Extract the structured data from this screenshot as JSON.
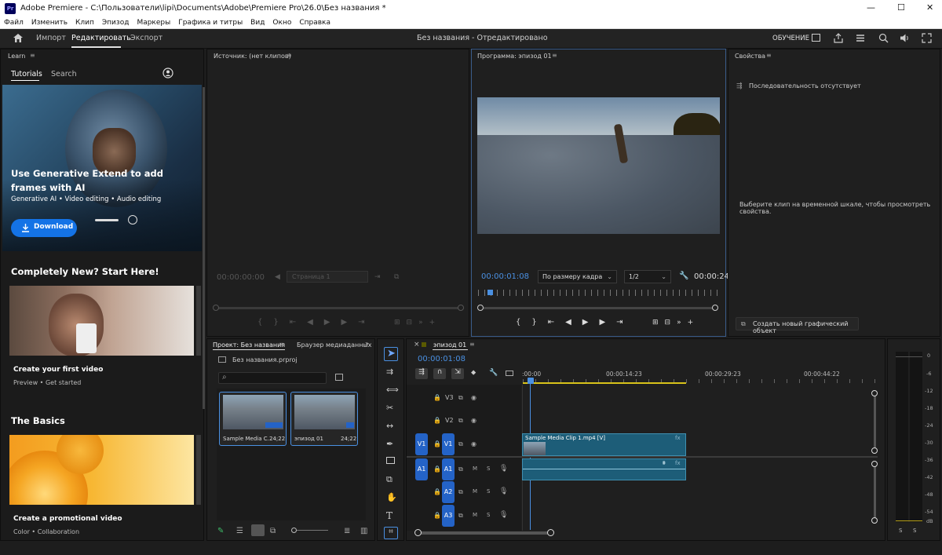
{
  "window": {
    "app": "Adobe Premiere",
    "path": "C:\\Пользователи\\lipi\\Documents\\Adobe\\Premiere Pro\\26.0\\Без названия *",
    "min": "—",
    "max": "☐",
    "close": "✕"
  },
  "menu": [
    "Файл",
    "Изменить",
    "Клип",
    "Эпизод",
    "Маркеры",
    "Графика и титры",
    "Вид",
    "Окно",
    "Справка"
  ],
  "header": {
    "tabs": [
      "Импорт",
      "Редактировать",
      "Экспорт"
    ],
    "active": 1,
    "center": "Без названия - Отредактировано",
    "learn": "ОБУЧЕНИЕ"
  },
  "learn": {
    "title": "Learn",
    "tabs": [
      "Tutorials",
      "Search"
    ],
    "hero": {
      "title": "Use Generative Extend to add frames with AI",
      "tags": "Generative AI  •  Video editing  •  Audio editing",
      "download": "Download"
    },
    "section1": "Completely New? Start Here!",
    "card1": {
      "title": "Create your first video",
      "tags": "Preview  •  Get started"
    },
    "section2": "The Basics",
    "card2": {
      "title": "Create a promotional video",
      "tags": "Color  •  Collaboration"
    }
  },
  "source": {
    "title": "Источник: (нет клипов)",
    "timecode": "00:00:00:00",
    "page": "Страница 1"
  },
  "program": {
    "title": "Программа: эпизод 01",
    "timecode": "00:00:01:08",
    "fit": "По размеру кадра",
    "res": "1/2",
    "end": "00:00:24"
  },
  "properties": {
    "title": "Свойства",
    "no_seq": "Последовательность отсутствует",
    "hint": "Выберите клип на временной шкале, чтобы просмотреть свойства.",
    "create": "Создать новый графический объект"
  },
  "project": {
    "title": "Проект: Без названия",
    "tab2": "Браузер медиаданных",
    "file": "Без названия.prproj",
    "items": [
      {
        "name": "Sample Media C...",
        "dur": "24;22"
      },
      {
        "name": "эпизод 01",
        "dur": "24;22"
      }
    ]
  },
  "timeline": {
    "title": "эпизод 01",
    "timecode": "00:00:01:08",
    "ruler": [
      ":00:00",
      "00:00:14:23",
      "00:00:29:23",
      "00:00:44:22"
    ],
    "tracks": [
      {
        "id": "V3"
      },
      {
        "id": "V2"
      },
      {
        "id": "V1",
        "src": "V1"
      },
      {
        "id": "A1",
        "src": "A1"
      },
      {
        "id": "A2"
      },
      {
        "id": "A3"
      }
    ],
    "clip": "Sample Media Clip 1.mp4 [V]",
    "audio_ms": [
      "M",
      "S"
    ]
  },
  "meter": {
    "scale": [
      "0",
      "-6",
      "-12",
      "-18",
      "-24",
      "-30",
      "-36",
      "-42",
      "-48",
      "-54"
    ],
    "dB": "dB",
    "s": [
      "S",
      "S"
    ]
  }
}
